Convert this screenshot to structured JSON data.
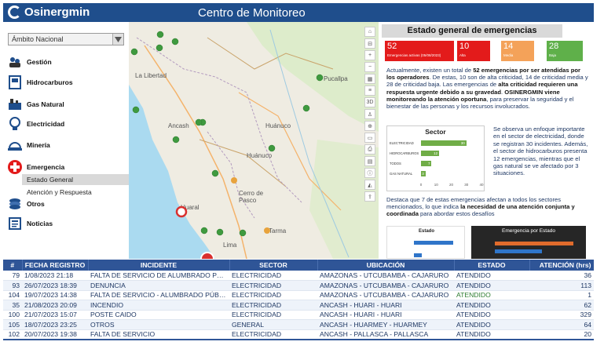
{
  "header": {
    "brand": "Osinergmin",
    "title": "Centro de Monitoreo"
  },
  "sidebar": {
    "scope": "Ámbito Nacional",
    "items": [
      {
        "label": "Gestión"
      },
      {
        "label": "Hidrocarburos"
      },
      {
        "label": "Gas Natural"
      },
      {
        "label": "Electricidad"
      },
      {
        "label": "Minería"
      },
      {
        "label": "Emergencia"
      },
      {
        "label": "Otros"
      },
      {
        "label": "Noticias"
      }
    ],
    "sub": [
      {
        "label": "Estado General",
        "active": true
      },
      {
        "label": "Atención y Respuesta",
        "active": false
      }
    ]
  },
  "map": {
    "labels": [
      "La Libertad",
      "Pucallpa",
      "Ancash",
      "Huánuco",
      "Huánuco",
      "Cerro de Pasco",
      "Huaral",
      "Tarma",
      "Lima"
    ]
  },
  "panel": {
    "title": "Estado general de emergencias",
    "kpis": [
      {
        "value": "52",
        "label": "Emergencias activas (05/08/2023)",
        "color": "#e31b1b"
      },
      {
        "value": "10",
        "label": "Alta",
        "color": "#e31b1b"
      },
      {
        "value": "14",
        "label": "Media",
        "color": "#f4a259"
      },
      {
        "value": "28",
        "label": "Baja",
        "color": "#5fb04a"
      }
    ],
    "p1": {
      "a": "Actualmente, existen un total de ",
      "b": "52 emergencias por ser atendidas por los operadores",
      "c": ". De estas, 10 son de alta criticidad, 14 de criticidad  media y 28 de criticidad  baja. Las emergencias de ",
      "d": "alta criticidad requieren una respuesta urgente debido a su gravedad",
      "e": ". ",
      "f": "OSINERGMIN viene monitoreando la atención oportuna",
      "g": ", para preservar la seguridad y el bienestar de las personas y los recursos involucrados."
    },
    "p2": "Se observa un  enfoque importante en el sector de electricidad, donde se registran 30 incidentes. Además, el sector de hidrocarburos presenta 12 emergencias, mientras que el gas natural se ve afectado por 3 situaciones.",
    "p3": {
      "a": "Destaca que 7 de estas emergencias afectan a todos los sectores mencionados, lo que indica ",
      "b": "la necesidad de una atención conjunta y coordinada",
      "c": " para abordar estos desafíos"
    },
    "mini1_title": "Estado",
    "mini2_title": "Emergencia por Estado"
  },
  "chart_data": {
    "type": "bar",
    "title": "Sector",
    "categories": [
      "ELECTRICIDAD",
      "HIDROCARBUROS",
      "TODOS",
      "GAS NATURAL"
    ],
    "values": [
      30,
      12,
      7,
      3
    ],
    "xlim": [
      0,
      40
    ],
    "ticks": [
      "0",
      "10",
      "20",
      "30",
      "40"
    ],
    "color": "#70ad47"
  },
  "table": {
    "headers": [
      "#",
      "FECHA REGISTRO",
      "INCIDENTE",
      "SECTOR",
      "UBICACIÓN",
      "ESTADO",
      "ATENCIÓN (hrs)"
    ],
    "rows": [
      [
        "79",
        "1/08/2023 21:18",
        "FALTA DE SERVICIO DE ALUMBRADO PÚBLICO",
        "ELECTRICIDAD",
        "AMAZONAS - UTCUBAMBA - CAJARURO",
        "ATENDIDO",
        "36"
      ],
      [
        "93",
        "26/07/2023 18:39",
        "DENUNCIA",
        "ELECTRICIDAD",
        "AMAZONAS - UTCUBAMBA - CAJARURO",
        "ATENDIDO",
        "113"
      ],
      [
        "104",
        "19/07/2023 14:38",
        "FALTA DE SERVICIO - ALUMBRADO PÚBLICO",
        "ELECTRICIDAD",
        "AMAZONAS - UTCUBAMBA - CAJARURO",
        "ATENDIDO",
        "1"
      ],
      [
        "35",
        "21/08/2023 20:09",
        "INCENDIO",
        "ELECTRICIDAD",
        "ANCASH - HUARI - HUARI",
        "ATENDIDO",
        "62"
      ],
      [
        "100",
        "21/07/2023 15:07",
        "POSTE CAIDO",
        "ELECTRICIDAD",
        "ANCASH - HUARI - HUARI",
        "ATENDIDO",
        "329"
      ],
      [
        "105",
        "18/07/2023 23:25",
        "OTROS",
        "GENERAL",
        "ANCASH - HUARMEY - HUARMEY",
        "ATENDIDO",
        "64"
      ],
      [
        "102",
        "20/07/2023 19:38",
        "FALTA DE SERVICIO",
        "ELECTRICIDAD",
        "ANCASH - PALLASCA - PALLASCA",
        "ATENDIDO",
        "20"
      ]
    ]
  }
}
